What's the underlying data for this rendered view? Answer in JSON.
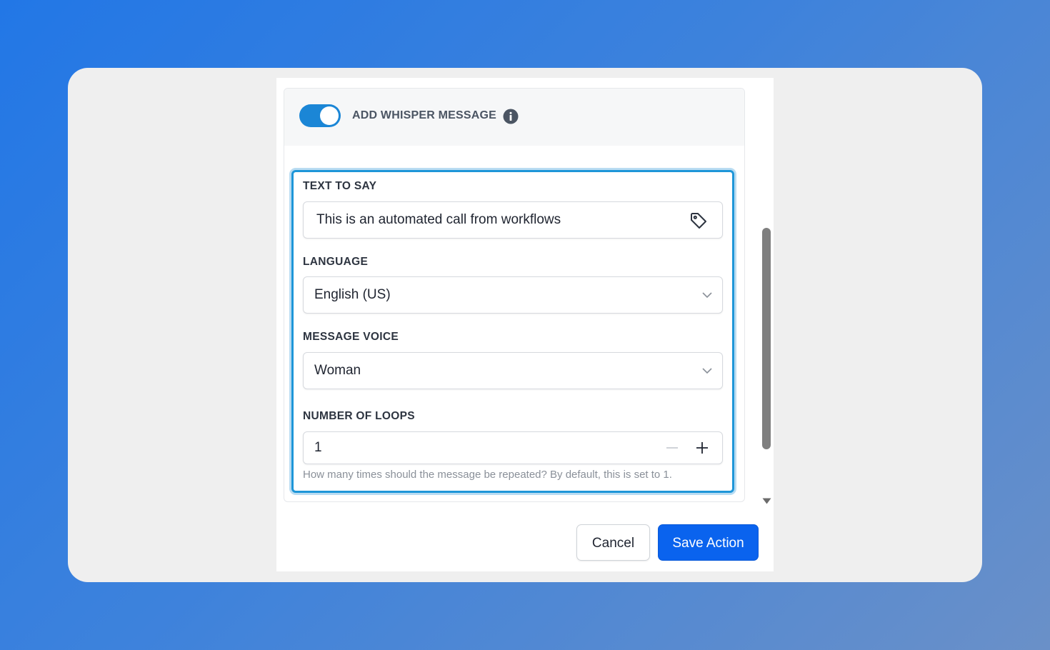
{
  "header": {
    "toggle_on": true,
    "label": "ADD WHISPER MESSAGE",
    "info_icon": "info-circle-icon"
  },
  "fields": {
    "text_to_say": {
      "label": "TEXT TO SAY",
      "value": "This is an automated call from workflows",
      "icon": "tag-icon"
    },
    "language": {
      "label": "LANGUAGE",
      "value": "English (US)"
    },
    "message_voice": {
      "label": "MESSAGE VOICE",
      "value": "Woman"
    },
    "number_of_loops": {
      "label": "NUMBER OF LOOPS",
      "value": "1",
      "help": "How many times should the message be repeated? By default, this is set to 1."
    }
  },
  "actions": {
    "cancel_label": "Cancel",
    "save_label": "Save Action"
  },
  "colors": {
    "accent": "#1b86d6",
    "focus_border": "#1e96d8",
    "primary_button": "#0a63ee"
  }
}
